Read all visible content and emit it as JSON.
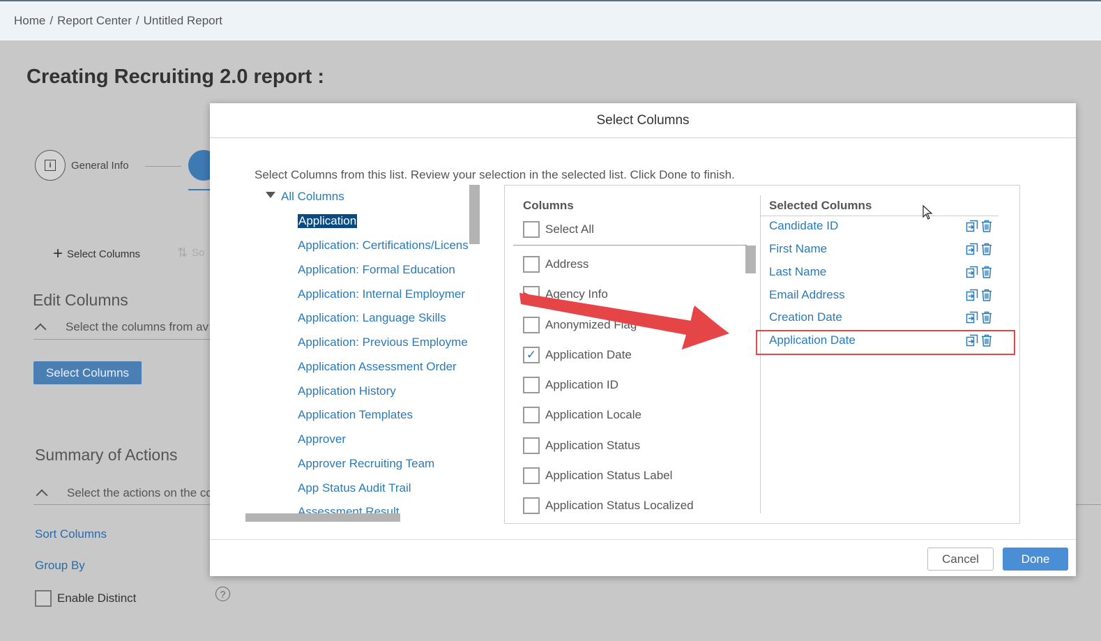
{
  "breadcrumb": [
    "Home",
    "Report Center",
    "Untitled Report"
  ],
  "page_title": "Creating Recruiting 2.0 report :",
  "steps": {
    "general_info": "General Info"
  },
  "toolbar": {
    "select_columns": "Select Columns",
    "sort_partial": "So"
  },
  "edit_columns": {
    "title": "Edit Columns",
    "subtitle": "Select the columns from av",
    "button": "Select Columns"
  },
  "summary": {
    "title": "Summary of Actions",
    "subtitle": "Select the actions on the co",
    "sort_columns": "Sort Columns",
    "group_by": "Group By",
    "enable_distinct": "Enable Distinct"
  },
  "modal": {
    "title": "Select Columns",
    "instructions": "Select Columns from this list. Review your selection in the selected list. Click Done to finish.",
    "tree_root": "All Columns",
    "tree_items": [
      "Application",
      "Application: Certifications/Licens",
      "Application: Formal Education",
      "Application: Internal Employmer",
      "Application: Language Skills",
      "Application: Previous Employme",
      "Application Assessment Order",
      "Application History",
      "Application Templates",
      "Approver",
      "Approver Recruiting Team",
      "App Status Audit Trail",
      "Assessment Result"
    ],
    "columns_header": "Columns",
    "select_all": "Select All",
    "columns": [
      {
        "label": "Address",
        "checked": false
      },
      {
        "label": "Agency Info",
        "checked": false
      },
      {
        "label": "Anonymized Flag",
        "checked": false
      },
      {
        "label": "Application Date",
        "checked": true
      },
      {
        "label": "Application ID",
        "checked": false
      },
      {
        "label": "Application Locale",
        "checked": false
      },
      {
        "label": "Application Status",
        "checked": false
      },
      {
        "label": "Application Status Label",
        "checked": false
      },
      {
        "label": "Application Status Localized",
        "checked": false
      }
    ],
    "selected_header": "Selected Columns",
    "selected": [
      "Candidate ID",
      "First Name",
      "Last Name",
      "Email Address",
      "Creation Date",
      "Application Date"
    ],
    "cancel": "Cancel",
    "done": "Done"
  },
  "colors": {
    "link": "#2a7ab8",
    "primary": "#4a8fd6",
    "annotation": "#e64548"
  }
}
